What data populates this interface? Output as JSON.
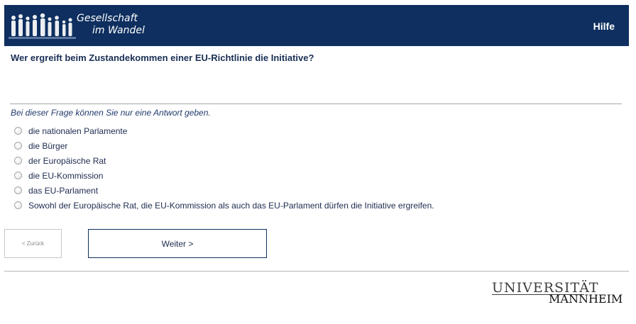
{
  "header": {
    "logo_line1": "Gesellschaft",
    "logo_line2": "im Wandel",
    "help_label": "Hilfe",
    "background": "#0e2f5f"
  },
  "question": {
    "text": "Wer ergreift beim Zustandekommen einer EU-Richtlinie die Initiative?",
    "instruction": "Bei dieser Frage können Sie nur eine Antwort geben.",
    "options": [
      "die nationalen Parlamente",
      "die Bürger",
      "der Europäische Rat",
      "die EU-Kommission",
      "das EU-Parlament",
      "Sowohl der Europäische Rat, die EU-Kommission als auch das EU-Parlament dürfen die Initiative ergreifen."
    ]
  },
  "navigation": {
    "back_label": "< Zurück",
    "next_label": "Weiter >"
  },
  "footer": {
    "university_top": "UNIVERSITÄT",
    "university_bottom": "MANNHEIM"
  }
}
